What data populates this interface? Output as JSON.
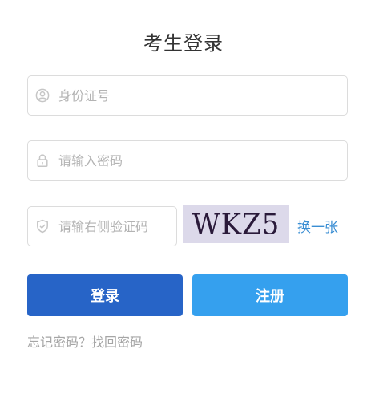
{
  "form": {
    "title": "考生登录",
    "id_field": {
      "placeholder": "身份证号",
      "value": "",
      "icon": "user-circle-icon"
    },
    "password_field": {
      "placeholder": "请输入密码",
      "value": "",
      "icon": "lock-icon"
    },
    "captcha_field": {
      "placeholder": "请输右侧验证码",
      "value": "",
      "icon": "shield-check-icon"
    },
    "captcha_image_text": "WKZ5",
    "refresh_label": "换一张",
    "login_label": "登录",
    "register_label": "注册",
    "forgot_label": "忘记密码？找回密码"
  },
  "colors": {
    "login_button": "#2764c7",
    "register_button": "#35a0ee",
    "link": "#3a8ed3",
    "captcha_background": "#dcd9ea"
  }
}
